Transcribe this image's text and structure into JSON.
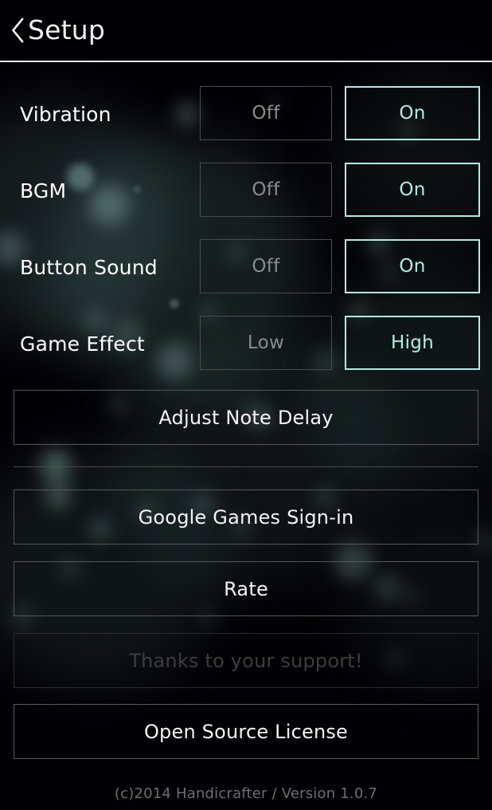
{
  "header": {
    "back_icon": "chevron-left-icon",
    "title": "Setup"
  },
  "settings": [
    {
      "label": "Vibration",
      "options": [
        {
          "label": "Off",
          "selected": false
        },
        {
          "label": "On",
          "selected": true
        }
      ]
    },
    {
      "label": "BGM",
      "options": [
        {
          "label": "Off",
          "selected": false
        },
        {
          "label": "On",
          "selected": true
        }
      ]
    },
    {
      "label": "Button Sound",
      "options": [
        {
          "label": "Off",
          "selected": false
        },
        {
          "label": "On",
          "selected": true
        }
      ]
    },
    {
      "label": "Game Effect",
      "options": [
        {
          "label": "Low",
          "selected": false
        },
        {
          "label": "High",
          "selected": true
        }
      ]
    }
  ],
  "actions": {
    "adjust_note_delay": "Adjust Note Delay",
    "google_games_sign_in": "Google Games Sign-in",
    "rate": "Rate",
    "thanks_support": "Thanks to your support!",
    "open_source_license": "Open Source License"
  },
  "footer": {
    "text": "(c)2014 Handicrafter / Version 1.0.7"
  },
  "colors": {
    "background": "#000005",
    "accent": "#b4ece6",
    "accent_border": "#b4e9e4",
    "text_primary": "#ffffff",
    "text_muted": "#8c8c8c",
    "text_disabled": "#3d3d3d",
    "button_border": "#585858",
    "inactive_border": "#4c4c4c",
    "footer_text": "#6e6e6e",
    "bokeh": "#9fc6c2"
  }
}
